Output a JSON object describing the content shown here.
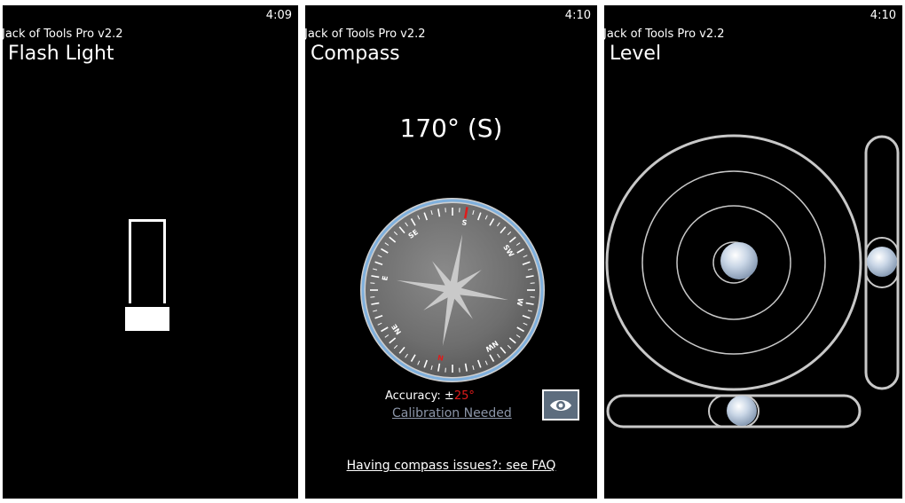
{
  "app_title": "Jack of Tools Pro v2.2",
  "screens": [
    {
      "clock": "4:09",
      "title": "Flash Light"
    },
    {
      "clock": "4:10",
      "title": "Compass",
      "heading": "170° (S)",
      "accuracy_label": "Accuracy: ±",
      "accuracy_value": "25°",
      "calibration": "Calibration Needed",
      "faq": "Having compass issues?: see FAQ",
      "dial_labels": [
        "S",
        "SW",
        "W",
        "NW",
        "N",
        "NE",
        "E",
        "SE"
      ],
      "colors": {
        "north": "#e01b1b",
        "bezel": "#7fb0dd",
        "dial": "#6e6e6e"
      },
      "view_icon": "eye-icon"
    },
    {
      "clock": "4:10",
      "title": "Level"
    }
  ]
}
